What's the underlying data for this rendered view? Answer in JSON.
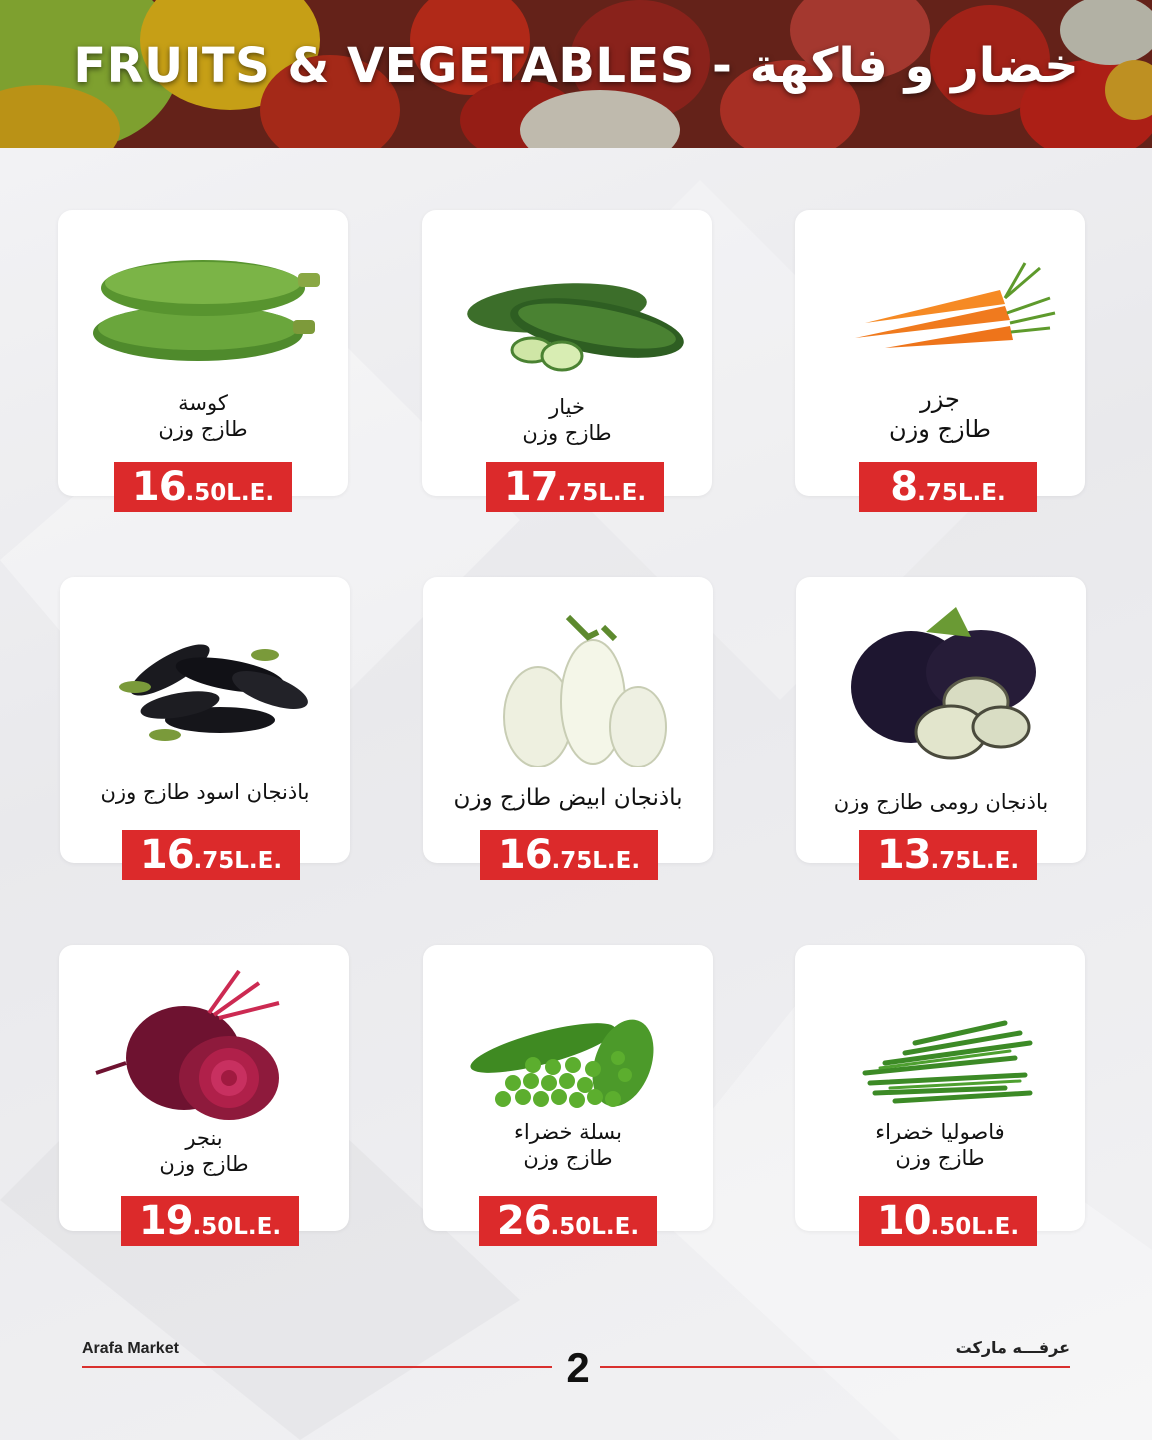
{
  "header": {
    "title": "FRUITS & VEGETABLES - خضار و فاكهة"
  },
  "colors": {
    "price_bg": "#dc2a2b",
    "accent_line": "#d9302e",
    "banner_dark": "#6d1e1a"
  },
  "products": [
    {
      "icon": "zucchini-icon",
      "name_line1": "كوسة",
      "name_line2": "طازج وزن",
      "price_int": "16",
      "price_dec": ".50L.E."
    },
    {
      "icon": "cucumber-icon",
      "name_line1": "خيار",
      "name_line2": "طازج وزن",
      "price_int": "17",
      "price_dec": ".75L.E."
    },
    {
      "icon": "carrot-icon",
      "name_line1": "جزر",
      "name_line2": "طازج وزن",
      "price_int": "8",
      "price_dec": ".75L.E."
    },
    {
      "icon": "black-eggplant-icon",
      "name_line1": "باذنجان اسود طازج وزن",
      "name_line2": "",
      "price_int": "16",
      "price_dec": ".75L.E."
    },
    {
      "icon": "white-eggplant-icon",
      "name_line1": "باذنجان ابيض طازج وزن",
      "name_line2": "",
      "price_int": "16",
      "price_dec": ".75L.E."
    },
    {
      "icon": "roman-eggplant-icon",
      "name_line1": "باذنجان رومى طازج وزن",
      "name_line2": "",
      "price_int": "13",
      "price_dec": ".75L.E."
    },
    {
      "icon": "beetroot-icon",
      "name_line1": "بنجر",
      "name_line2": "طازج وزن",
      "price_int": "19",
      "price_dec": ".50L.E."
    },
    {
      "icon": "green-peas-icon",
      "name_line1": "بسلة خضراء",
      "name_line2": "طازج وزن",
      "price_int": "26",
      "price_dec": ".50L.E."
    },
    {
      "icon": "green-beans-icon",
      "name_line1": "فاصوليا خضراء",
      "name_line2": "طازج وزن",
      "price_int": "10",
      "price_dec": ".50L.E."
    }
  ],
  "footer": {
    "left": "Arafa Market",
    "right": "عرفـــه ماركت",
    "page": "2"
  }
}
